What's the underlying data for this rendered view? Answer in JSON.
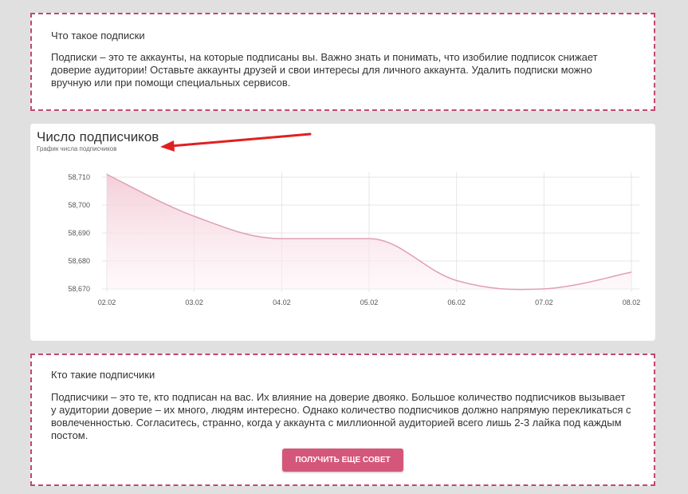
{
  "tips": {
    "top": {
      "title": "Что такое подписки",
      "text": "Подписки – это те аккаунты, на которые подписаны вы. Важно знать и понимать, что изобилие подписок снижает доверие аудитории! Оставьте аккаунты друзей и свои интересы для личного аккаунта. Удалить подписки можно вручную или при помощи специальных сервисов."
    },
    "bottom": {
      "title": "Кто такие подписчики",
      "text": "Подписчики – это те, кто подписан на вас. Их влияние на доверие двояко. Большое количество подписчиков вызывает у аудитории доверие – их много, людям интересно. Однако количество подписчиков должно напрямую перекликаться с вовлеченностью. Согласитесь, странно, когда у аккаунта с миллионной аудиторией всего лишь 2-3 лайка под каждым постом.",
      "button_label": "ПОЛУЧИТЬ ЕЩЕ СОВЕТ"
    }
  },
  "colors": {
    "accent": "#d4577a",
    "dashed_border": "#c2486e",
    "line": "#e0a0b4",
    "annotation_arrow": "#e02020"
  },
  "chart_data": {
    "type": "area",
    "title": "Число подписчиков",
    "subtitle": "График числа подписчиков",
    "categories": [
      "02.02",
      "03.02",
      "04.02",
      "05.02",
      "06.02",
      "07.02",
      "08.02"
    ],
    "series": [
      {
        "values": [
          58711,
          58696,
          58688,
          58688,
          58673,
          58670,
          58676
        ]
      }
    ],
    "y_ticks": [
      "58,670",
      "58,680",
      "58,690",
      "58,700",
      "58,710"
    ],
    "ylim": [
      58670,
      58710
    ],
    "grid": true
  }
}
